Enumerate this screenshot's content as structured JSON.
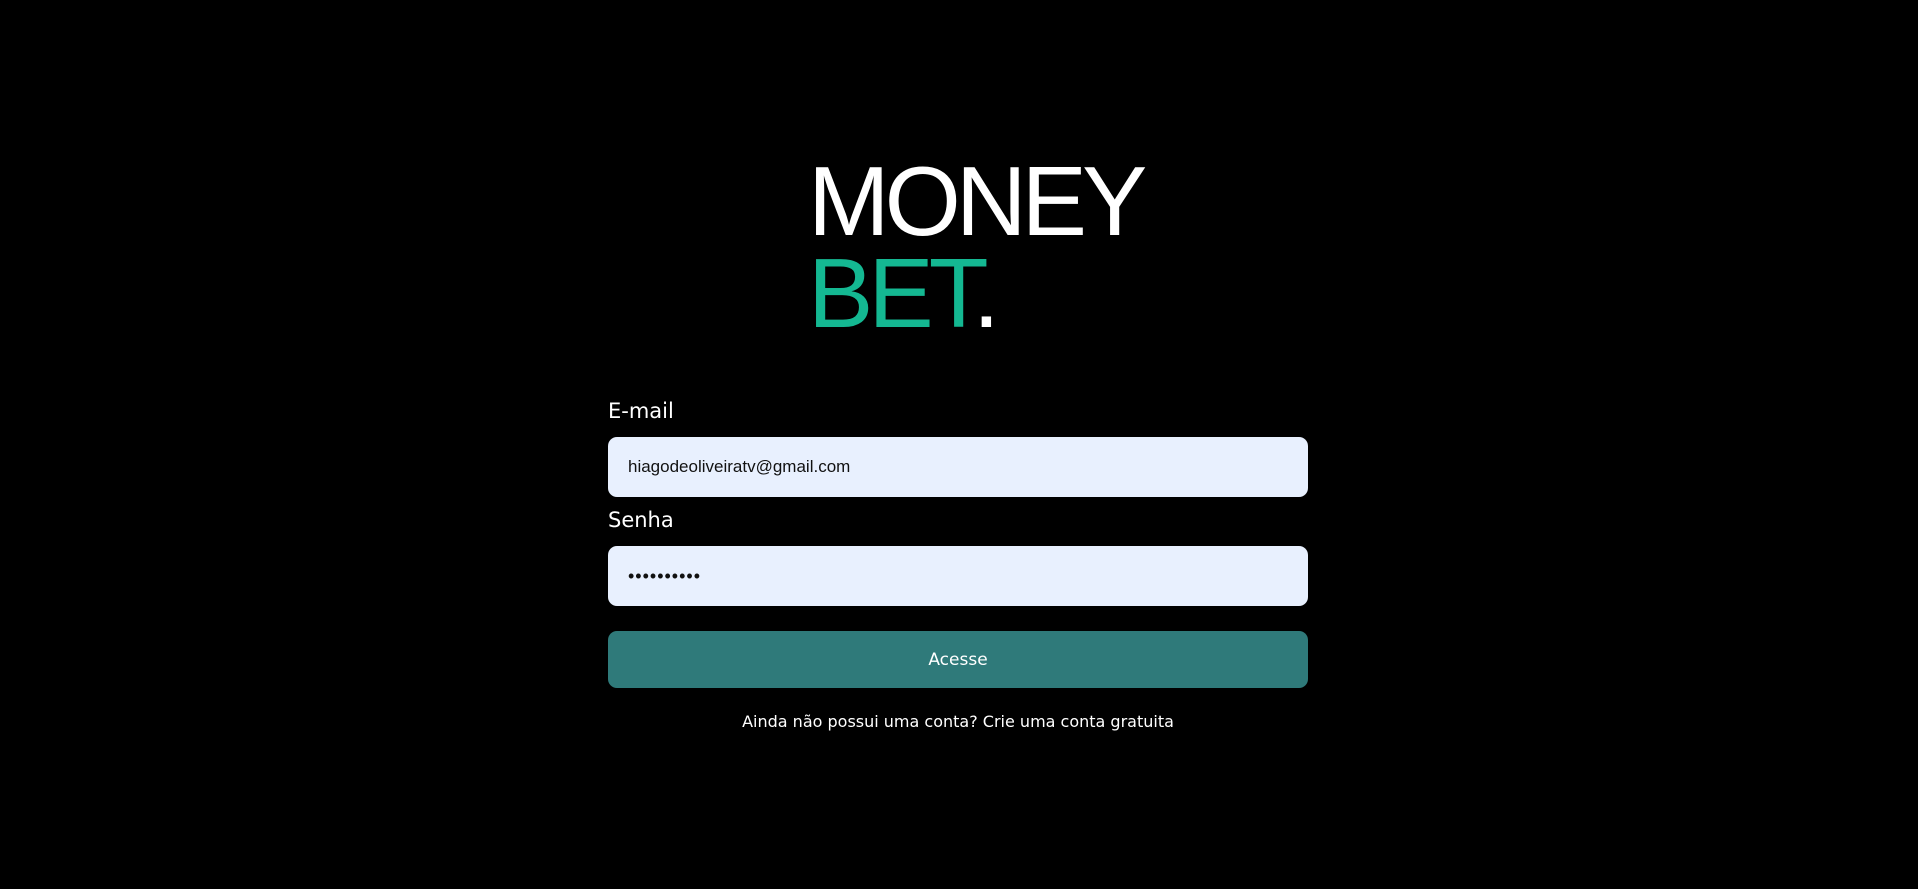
{
  "logo": {
    "line1": "MONEY",
    "line2_accent": "BET",
    "line2_dot": ".",
    "accent_color": "#14b892"
  },
  "form": {
    "email_label": "E-mail",
    "email_value": "hiagodeoliveiratv@gmail.com",
    "password_label": "Senha",
    "password_value": "••••••••••",
    "submit_label": "Acesse",
    "submit_color": "#2f7a7a",
    "input_background": "#e8f0fe"
  },
  "signup": {
    "prompt": "Ainda não possui uma conta?",
    "link_label": "Crie uma conta gratuita"
  }
}
